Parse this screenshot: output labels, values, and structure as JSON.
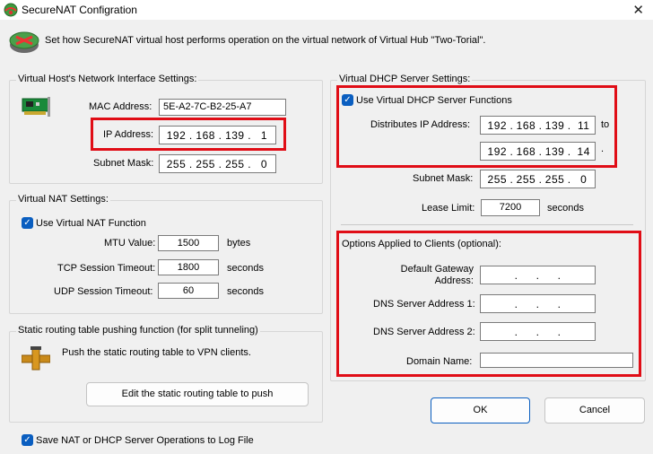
{
  "window": {
    "title": "SecureNAT Configration",
    "close_symbol": "✕"
  },
  "header": {
    "description": "Set how SecureNAT virtual host performs operation on the virtual network of Virtual Hub \"Two-Torial\"."
  },
  "host_settings": {
    "title": "Virtual Host's Network Interface Settings:",
    "mac_label": "MAC Address:",
    "mac_value": "5E-A2-7C-B2-25-A7",
    "ip_label": "IP Address:",
    "ip": [
      "192",
      "168",
      "139",
      "1"
    ],
    "subnet_label": "Subnet Mask:",
    "subnet": [
      "255",
      "255",
      "255",
      "0"
    ]
  },
  "nat_settings": {
    "title": "Virtual NAT Settings:",
    "use_label": "Use Virtual NAT Function",
    "mtu_label": "MTU Value:",
    "mtu_value": "1500",
    "mtu_unit": "bytes",
    "tcp_label": "TCP Session Timeout:",
    "tcp_value": "1800",
    "tcp_unit": "seconds",
    "udp_label": "UDP Session Timeout:",
    "udp_value": "60",
    "udp_unit": "seconds"
  },
  "routing": {
    "title": "Static routing table pushing function (for split tunneling)",
    "description": "Push the static routing table to VPN clients.",
    "edit_button": "Edit the static routing table to push"
  },
  "log": {
    "label": "Save NAT or DHCP Server Operations to Log File"
  },
  "dhcp": {
    "title": "Virtual DHCP Server Settings:",
    "use_label": "Use Virtual DHCP Server Functions",
    "distributes_label": "Distributes IP Address:",
    "ip_start": [
      "192",
      "168",
      "139",
      "11"
    ],
    "to_label": "to",
    "ip_end": [
      "192",
      "168",
      "139",
      "14"
    ],
    "end_period": ".",
    "subnet_label": "Subnet Mask:",
    "subnet": [
      "255",
      "255",
      "255",
      "0"
    ],
    "lease_label": "Lease Limit:",
    "lease_value": "7200",
    "lease_unit": "seconds"
  },
  "options": {
    "title": "Options Applied to Clients (optional):",
    "gateway_label_line1": "Default Gateway",
    "gateway_label_line2": "Address:",
    "dns1_label": "DNS Server Address 1:",
    "dns2_label": "DNS Server Address 2:",
    "domain_label": "Domain Name:",
    "domain_value": ""
  },
  "buttons": {
    "ok": "OK",
    "cancel": "Cancel"
  },
  "icons": {
    "app": "securenat-globe-icon",
    "header": "router-icon",
    "nic": "network-card-icon",
    "routing": "pipe-valve-icon",
    "check": "checkmark-icon"
  },
  "colors": {
    "highlight_box": "#e00d16",
    "checkbox": "#0a5ec0"
  }
}
